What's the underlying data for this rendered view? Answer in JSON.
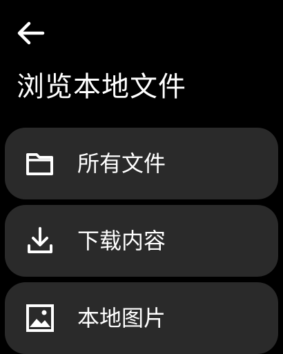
{
  "header": {
    "back_icon": "arrow-left-icon",
    "title": "浏览本地文件"
  },
  "items": [
    {
      "label": "所有文件",
      "icon": "folder-icon"
    },
    {
      "label": "下载内容",
      "icon": "download-icon"
    },
    {
      "label": "本地图片",
      "icon": "image-icon"
    }
  ],
  "colors": {
    "background": "#000000",
    "card": "#2a2a2a",
    "text": "#ffffff"
  }
}
